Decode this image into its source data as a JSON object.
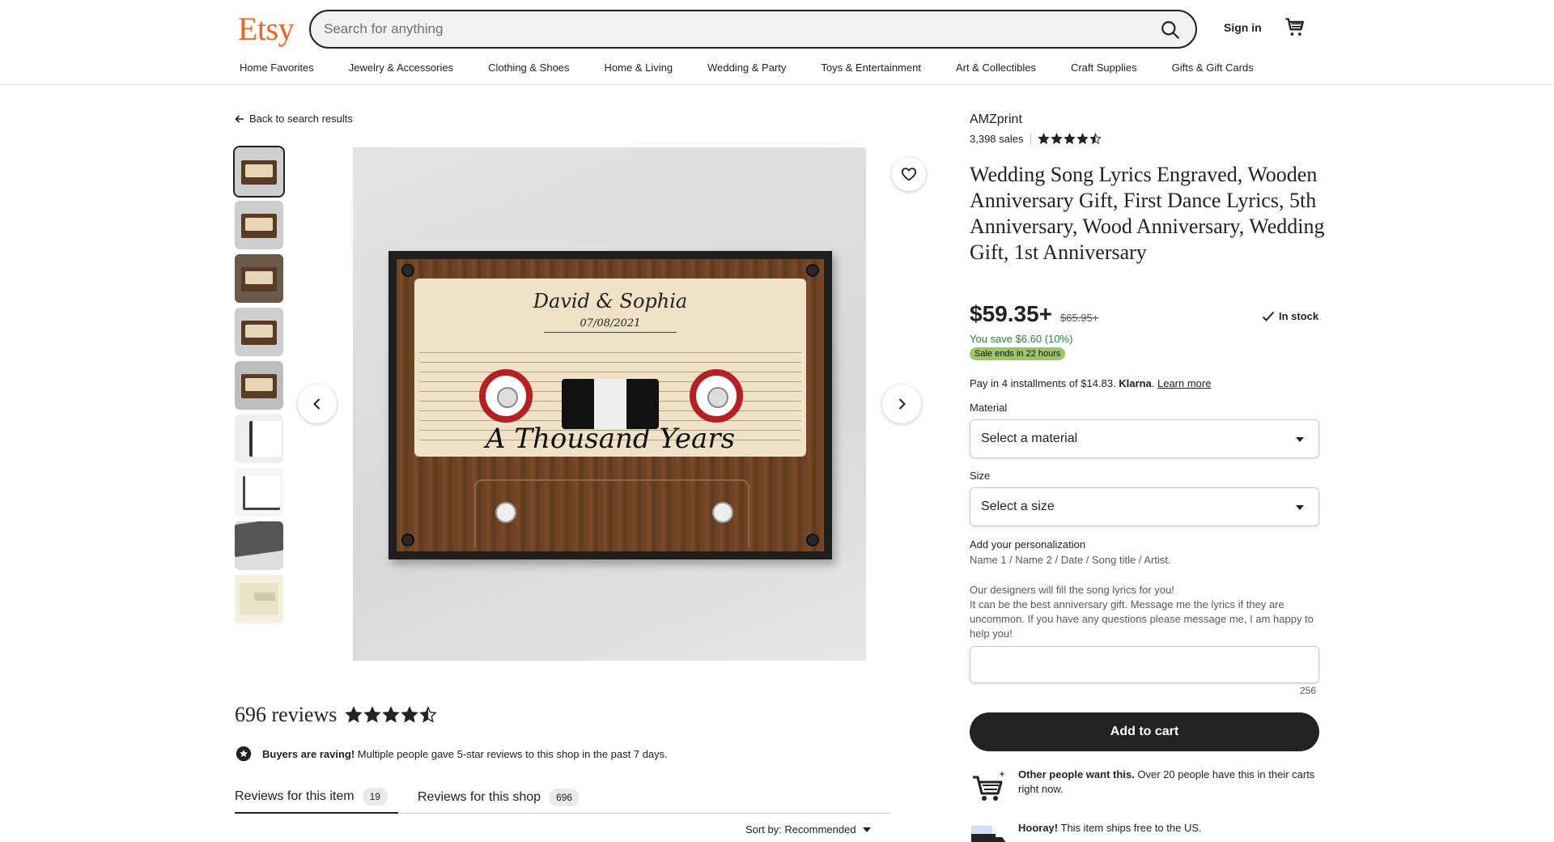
{
  "header": {
    "logo": "Etsy",
    "search_placeholder": "Search for anything",
    "signin": "Sign in",
    "nav": [
      "Home Favorites",
      "Jewelry & Accessories",
      "Clothing & Shoes",
      "Home & Living",
      "Wedding & Party",
      "Toys & Entertainment",
      "Art & Collectibles",
      "Craft Supplies",
      "Gifts & Gift Cards"
    ]
  },
  "gallery": {
    "back_link": "Back to search results",
    "artwork": {
      "names": "David & Sophia",
      "date": "07/08/2021",
      "song": "A Thousand Years"
    }
  },
  "reviews": {
    "count_label": "696 reviews",
    "rating": 4.5,
    "raving_bold": "Buyers are raving!",
    "raving_text": " Multiple people gave 5-star reviews to this shop in the past 7 days.",
    "tab_item_label": "Reviews for this item",
    "tab_item_count": "19",
    "tab_shop_label": "Reviews for this shop",
    "tab_shop_count": "696",
    "sort_label": "Sort by: Recommended"
  },
  "listing": {
    "shop_name": "AMZprint",
    "sales": "3,398 sales",
    "shop_rating": 4.5,
    "title": "Wedding Song Lyrics Engraved, Wooden Anniversary Gift, First Dance Lyrics, 5th Anniversary, Wood Anniversary, Wedding Gift, 1st Anniversary",
    "price": "$59.35+",
    "old_price": "$65.95+",
    "stock": "In stock",
    "save": "You save $6.60 (10%)",
    "sale_badge": "Sale ends in 22 hours",
    "klarna_prefix": "Pay in 4 installments of $14.83. ",
    "klarna_brand": "Klarna",
    "klarna_dot": ". ",
    "klarna_link": "Learn more",
    "material_label": "Material",
    "material_value": "Select a material",
    "size_label": "Size",
    "size_value": "Select a size",
    "personal_label": "Add your personalization",
    "personal_hint": "Name 1 / Name 2 / Date / Song title / Artist.",
    "personal_line1": "Our designers will fill the song lyrics for you!",
    "personal_line2": "It can be the best anniversary gift. Message me the lyrics if they are uncommon. If you have any questions please message me, I am happy to help you!",
    "char_count": "256",
    "add_to_cart": "Add to cart",
    "promo1_bold": "Other people want this.",
    "promo1_text": " Over 20 people have this in their carts right now.",
    "promo2_bold": "Hooray!",
    "promo2_text": " This item ships free to the US."
  },
  "colors": {
    "brand": "#f1641e",
    "primary_button": "#222222",
    "save_text": "#258635",
    "sale_badge": "#9ec46f"
  }
}
